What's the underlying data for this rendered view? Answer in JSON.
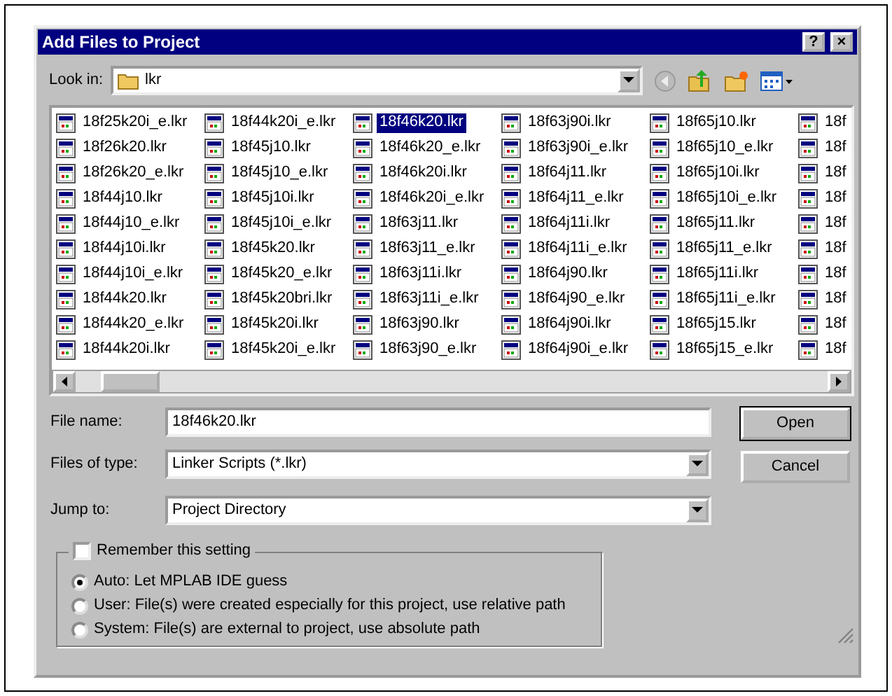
{
  "window": {
    "title": "Add Files to Project",
    "help_button": "?",
    "close_button": "×"
  },
  "look_in": {
    "label": "Look in:",
    "value": "lkr"
  },
  "files": [
    {
      "name": "18f25k20i_e.lkr",
      "selected": false
    },
    {
      "name": "18f26k20.lkr",
      "selected": false
    },
    {
      "name": "18f26k20_e.lkr",
      "selected": false
    },
    {
      "name": "18f44j10.lkr",
      "selected": false
    },
    {
      "name": "18f44j10_e.lkr",
      "selected": false
    },
    {
      "name": "18f44j10i.lkr",
      "selected": false
    },
    {
      "name": "18f44j10i_e.lkr",
      "selected": false
    },
    {
      "name": "18f44k20.lkr",
      "selected": false
    },
    {
      "name": "18f44k20_e.lkr",
      "selected": false
    },
    {
      "name": "18f44k20i.lkr",
      "selected": false
    },
    {
      "name": "18f44k20i_e.lkr",
      "selected": false
    },
    {
      "name": "18f45j10.lkr",
      "selected": false
    },
    {
      "name": "18f45j10_e.lkr",
      "selected": false
    },
    {
      "name": "18f45j10i.lkr",
      "selected": false
    },
    {
      "name": "18f45j10i_e.lkr",
      "selected": false
    },
    {
      "name": "18f45k20.lkr",
      "selected": false
    },
    {
      "name": "18f45k20_e.lkr",
      "selected": false
    },
    {
      "name": "18f45k20bri.lkr",
      "selected": false
    },
    {
      "name": "18f45k20i.lkr",
      "selected": false
    },
    {
      "name": "18f45k20i_e.lkr",
      "selected": false
    },
    {
      "name": "18f46k20.lkr",
      "selected": true
    },
    {
      "name": "18f46k20_e.lkr",
      "selected": false
    },
    {
      "name": "18f46k20i.lkr",
      "selected": false
    },
    {
      "name": "18f46k20i_e.lkr",
      "selected": false
    },
    {
      "name": "18f63j11.lkr",
      "selected": false
    },
    {
      "name": "18f63j11_e.lkr",
      "selected": false
    },
    {
      "name": "18f63j11i.lkr",
      "selected": false
    },
    {
      "name": "18f63j11i_e.lkr",
      "selected": false
    },
    {
      "name": "18f63j90.lkr",
      "selected": false
    },
    {
      "name": "18f63j90_e.lkr",
      "selected": false
    },
    {
      "name": "18f63j90i.lkr",
      "selected": false
    },
    {
      "name": "18f63j90i_e.lkr",
      "selected": false
    },
    {
      "name": "18f64j11.lkr",
      "selected": false
    },
    {
      "name": "18f64j11_e.lkr",
      "selected": false
    },
    {
      "name": "18f64j11i.lkr",
      "selected": false
    },
    {
      "name": "18f64j11i_e.lkr",
      "selected": false
    },
    {
      "name": "18f64j90.lkr",
      "selected": false
    },
    {
      "name": "18f64j90_e.lkr",
      "selected": false
    },
    {
      "name": "18f64j90i.lkr",
      "selected": false
    },
    {
      "name": "18f64j90i_e.lkr",
      "selected": false
    },
    {
      "name": "18f65j10.lkr",
      "selected": false
    },
    {
      "name": "18f65j10_e.lkr",
      "selected": false
    },
    {
      "name": "18f65j10i.lkr",
      "selected": false
    },
    {
      "name": "18f65j10i_e.lkr",
      "selected": false
    },
    {
      "name": "18f65j11.lkr",
      "selected": false
    },
    {
      "name": "18f65j11_e.lkr",
      "selected": false
    },
    {
      "name": "18f65j11i.lkr",
      "selected": false
    },
    {
      "name": "18f65j11i_e.lkr",
      "selected": false
    },
    {
      "name": "18f65j15.lkr",
      "selected": false
    },
    {
      "name": "18f65j15_e.lkr",
      "selected": false
    },
    {
      "name": "18f",
      "selected": false
    },
    {
      "name": "18f",
      "selected": false
    },
    {
      "name": "18f",
      "selected": false
    },
    {
      "name": "18f",
      "selected": false
    },
    {
      "name": "18f",
      "selected": false
    },
    {
      "name": "18f",
      "selected": false
    },
    {
      "name": "18f",
      "selected": false
    },
    {
      "name": "18f",
      "selected": false
    },
    {
      "name": "18f",
      "selected": false
    },
    {
      "name": "18f",
      "selected": false
    }
  ],
  "file_name": {
    "label": "File name:",
    "value": "18f46k20.lkr"
  },
  "file_type": {
    "label": "Files of type:",
    "value": "Linker Scripts (*.lkr)"
  },
  "jump_to": {
    "label": "Jump to:",
    "value": "Project Directory"
  },
  "buttons": [
    {
      "label": "Open",
      "default": true
    },
    {
      "label": "Cancel",
      "default": false
    }
  ],
  "remember": {
    "label": "Remember this setting",
    "checked": false
  },
  "path_options": [
    {
      "label": "Auto: Let MPLAB IDE guess",
      "selected": true
    },
    {
      "label": "User: File(s) were created especially for this project, use relative path",
      "selected": false
    },
    {
      "label": "System: File(s) are external to project, use absolute path",
      "selected": false
    }
  ]
}
